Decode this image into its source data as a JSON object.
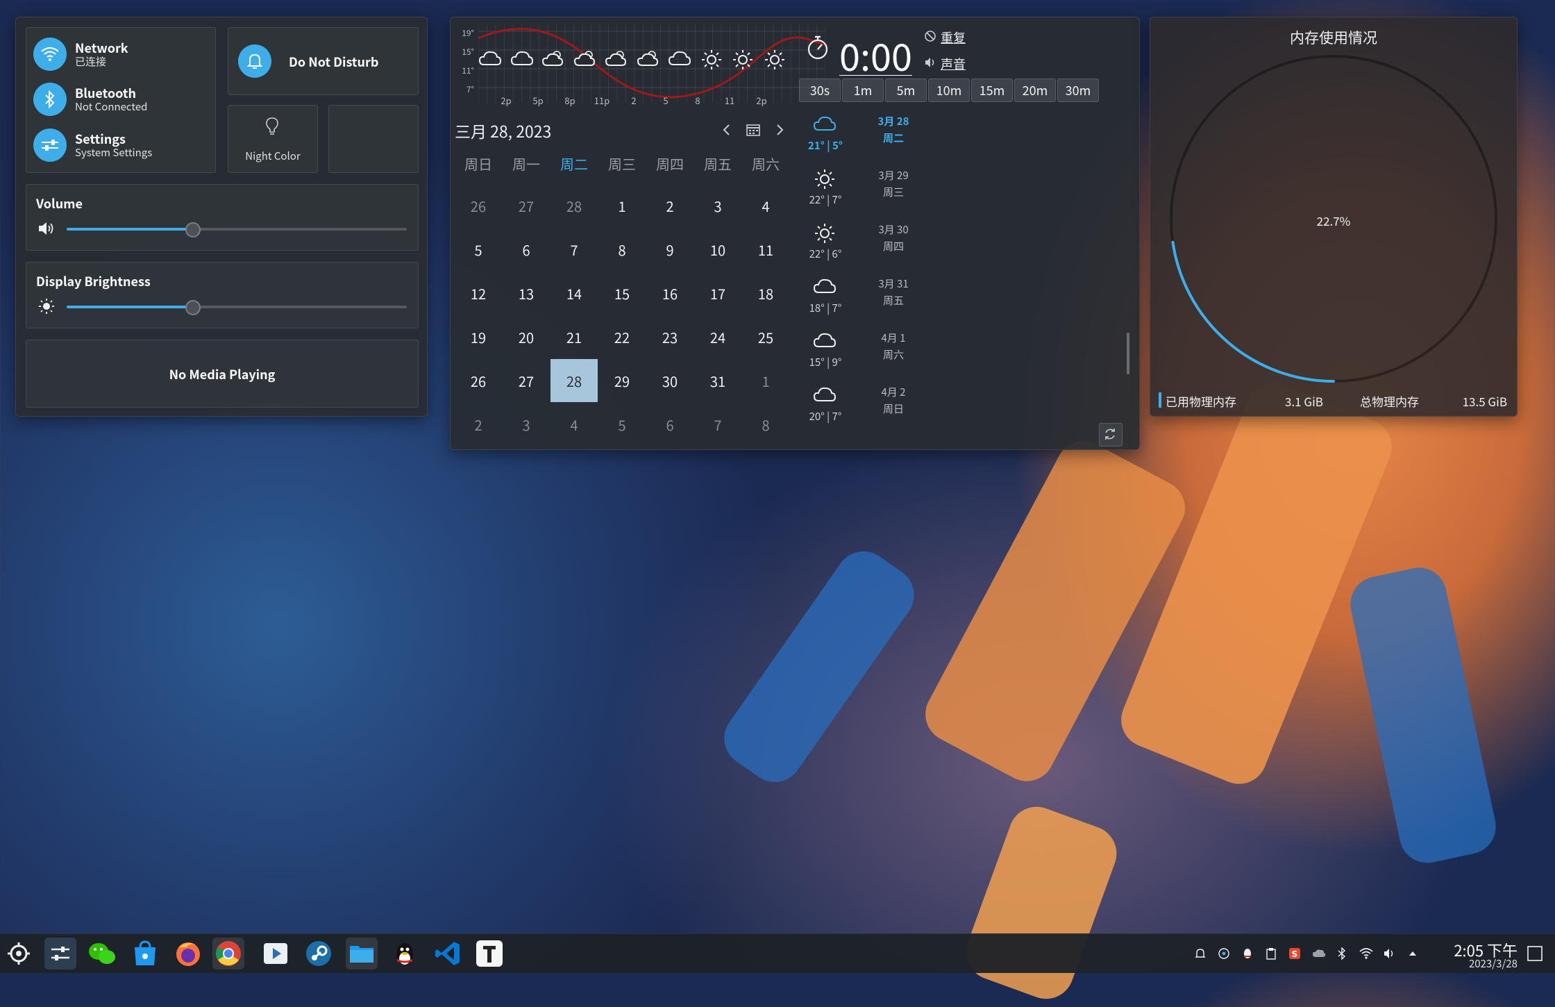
{
  "quick_settings": {
    "network": {
      "title": "Network",
      "subtitle": "已连接"
    },
    "bluetooth": {
      "title": "Bluetooth",
      "subtitle": "Not Connected"
    },
    "settings": {
      "title": "Settings",
      "subtitle": "System Settings"
    },
    "dnd": {
      "title": "Do Not Disturb"
    },
    "night_color": {
      "title": "Night Color"
    },
    "volume": {
      "title": "Volume",
      "level": 0.37
    },
    "brightness": {
      "title": "Display Brightness",
      "level": 0.37
    },
    "media": {
      "title": "No Media Playing"
    }
  },
  "weather_chart": {
    "y_ticks": [
      "19°",
      "15°",
      "11°",
      "7°"
    ],
    "x_ticks": [
      "2p",
      "5p",
      "8p",
      "11p",
      "2",
      "5",
      "8",
      "11",
      "2p"
    ],
    "icons": [
      "cloud-icon",
      "cloud-icon",
      "cloud-sun-icon",
      "cloud-sun-icon",
      "cloud-sun-icon",
      "cloud-sun-icon",
      "cloud-icon",
      "sun-icon",
      "sun-icon",
      "sun-icon"
    ]
  },
  "calendar": {
    "title": "三月 28, 2023",
    "weekdays": [
      "周日",
      "周一",
      "周二",
      "周三",
      "周四",
      "周五",
      "周六"
    ],
    "active_weekday": 2,
    "weeks": [
      [
        "26",
        "27",
        "28",
        "1",
        "2",
        "3",
        "4"
      ],
      [
        "5",
        "6",
        "7",
        "8",
        "9",
        "10",
        "11"
      ],
      [
        "12",
        "13",
        "14",
        "15",
        "16",
        "17",
        "18"
      ],
      [
        "19",
        "20",
        "21",
        "22",
        "23",
        "24",
        "25"
      ],
      [
        "26",
        "27",
        "28",
        "29",
        "30",
        "31",
        "1"
      ],
      [
        "2",
        "3",
        "4",
        "5",
        "6",
        "7",
        "8"
      ]
    ],
    "today": "28"
  },
  "timer": {
    "display": "0:00",
    "repeat_label": "重复",
    "sound_label": "声音",
    "presets": [
      "30s",
      "1m",
      "5m",
      "10m",
      "15m",
      "20m",
      "30m"
    ]
  },
  "forecast": [
    {
      "icon": "cloud-icon",
      "temp": "21° | 5°",
      "date": "3月 28",
      "day": "周二",
      "today": true
    },
    {
      "icon": "sun-icon",
      "temp": "22° | 7°",
      "date": "3月 29",
      "day": "周三"
    },
    {
      "icon": "sun-icon",
      "temp": "22° | 6°",
      "date": "3月 30",
      "day": "周四"
    },
    {
      "icon": "cloud-icon",
      "temp": "18° | 7°",
      "date": "3月 31",
      "day": "周五"
    },
    {
      "icon": "cloud-icon",
      "temp": "15° | 9°",
      "date": "4月 1",
      "day": "周六"
    },
    {
      "icon": "cloud-icon",
      "temp": "20° | 7°",
      "date": "4月 2",
      "day": "周日"
    }
  ],
  "memory": {
    "title": "内存使用情况",
    "percent_label": "22.7%",
    "percent": 0.227,
    "used_label": "已用物理内存",
    "used_value": "3.1 GiB",
    "total_label": "总物理内存",
    "total_value": "13.5 GiB",
    "accent": "#3daee9"
  },
  "taskbar": {
    "clock_time": "2:05 下午",
    "clock_date": "2023/3/28",
    "apps": [
      "launcher-icon",
      "system-settings-icon",
      "wechat-icon",
      "discover-icon",
      "firefox-icon",
      "chrome-icon",
      "media-player-icon",
      "steam-icon",
      "dolphin-icon",
      "qq-icon",
      "vscode-icon",
      "typora-icon"
    ]
  }
}
